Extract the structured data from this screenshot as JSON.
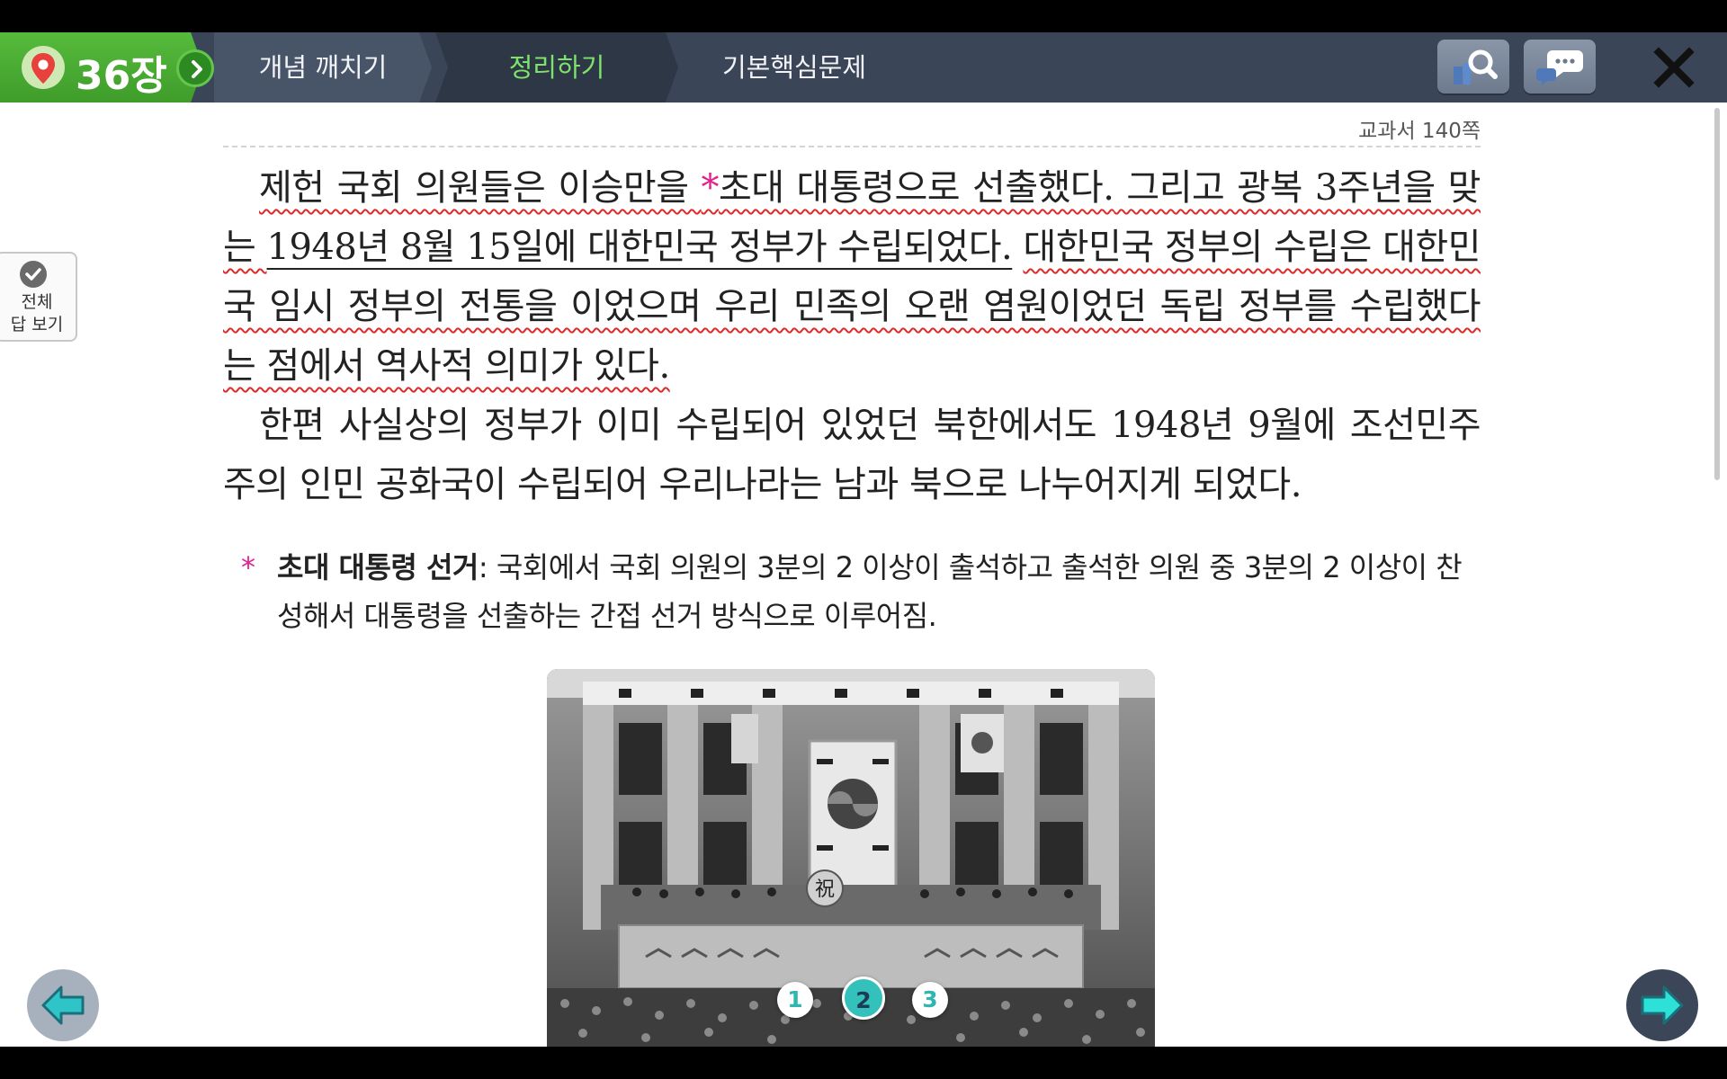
{
  "nav": {
    "chapter": "36장",
    "tabs": [
      {
        "label": "개념 깨치기"
      },
      {
        "label": "정리하기"
      },
      {
        "label": "기본핵심문제"
      }
    ],
    "active_tab": "정리하기"
  },
  "page_ref": "교과서 140쪽",
  "show_all": {
    "line1": "전체",
    "line2": "답 보기"
  },
  "body": {
    "p1_indent": "제헌 국회 의원들은 이승만을 ",
    "star": "*",
    "p1_seg1": "초대 대통령으로 선출했다.",
    "p1_seg2": " 그리고 광복 3주년을 맞는 ",
    "p1_seg3": "1948년 8월 15일에 대한민국 정부가 수립되었다.",
    "p1_seg4": " ",
    "p1_seg5": "대한민국 정부의 수립은 대한민국 임시 정부의 전통을 이었으며 우리 민족의 오랜 염원이었던 독립 정부를 수립했다는 점에서 역사적 의미가 있다.",
    "p2": "한편 사실상의 정부가 이미 수립되어 있었던 북한에서도 1948년 9월에 조선민주주의 인민 공화국이 수립되어 우리나라는 남과 북으로 나누어지게 되었다."
  },
  "footnote": {
    "star": "*",
    "term": "초대 대통령 선거",
    "text": ": 국회에서 국회 의원의 3분의 2 이상이 출석하고 출석한 의원 중 3분의 2 이상이 찬성해서 대통령을 선출하는 간접 선거 방식으로 이루어짐."
  },
  "photo": {
    "sign_char": "祝"
  },
  "pagination": [
    "1",
    "2",
    "3"
  ],
  "current_page": "2",
  "colors": {
    "nav_bg": "#3a4658",
    "chapter_green": "#4caf35",
    "active_tab_text": "#7de36a",
    "wavy_underline": "#e02a2a",
    "star_pink": "#e2208e",
    "teal": "#35c1bb"
  },
  "icons": [
    "location-pin-icon",
    "chevron-right-icon",
    "book-search-icon",
    "chat-icon",
    "close-icon",
    "check-icon",
    "arrow-left-icon",
    "arrow-right-icon"
  ]
}
